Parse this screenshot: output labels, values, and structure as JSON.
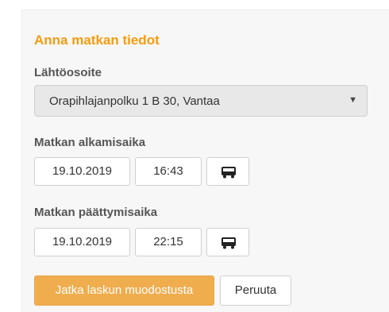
{
  "form": {
    "title": "Anna matkan tiedot",
    "start_address": {
      "label": "Lähtöosoite",
      "selected": "Orapihlajanpolku 1 B 30, Vantaa"
    },
    "start_time": {
      "label": "Matkan alkamisaika",
      "date": "19.10.2019",
      "time": "16:43",
      "icon": "bus-icon"
    },
    "end_time": {
      "label": "Matkan päättymisaika",
      "date": "19.10.2019",
      "time": "22:15",
      "icon": "bus-icon"
    },
    "buttons": {
      "continue": "Jatka laskun muodostusta",
      "cancel": "Peruuta"
    }
  },
  "colors": {
    "accent": "#f39c12",
    "primary_button": "#f0ad4e"
  }
}
